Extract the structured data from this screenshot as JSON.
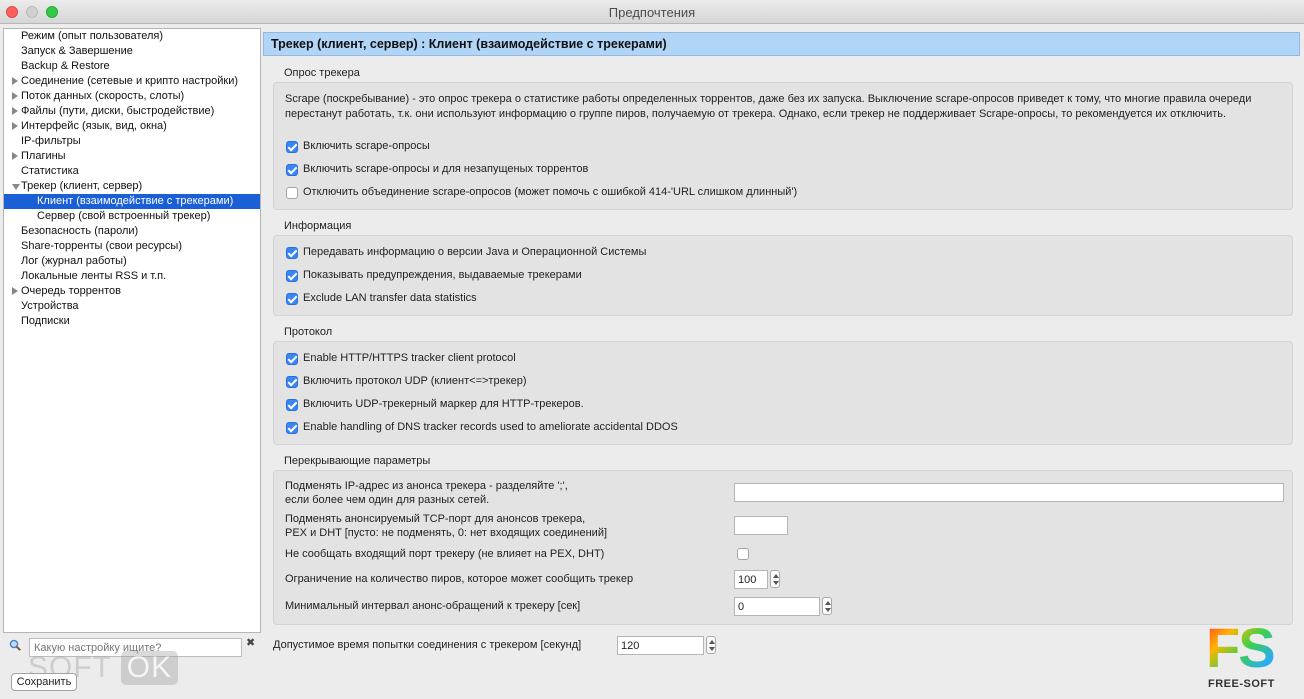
{
  "window": {
    "title": "Предпочтения"
  },
  "sidebar": {
    "items": [
      {
        "label": "Режим (опыт пользователя)",
        "arrow": "none",
        "indent": 0,
        "selected": false
      },
      {
        "label": "Запуск & Завершение",
        "arrow": "none",
        "indent": 0,
        "selected": false
      },
      {
        "label": "Backup & Restore",
        "arrow": "none",
        "indent": 0,
        "selected": false
      },
      {
        "label": "Соединение (сетевые и крипто настройки)",
        "arrow": "right",
        "indent": 0,
        "selected": false
      },
      {
        "label": "Поток данных (скорость, слоты)",
        "arrow": "right",
        "indent": 0,
        "selected": false
      },
      {
        "label": "Файлы (пути, диски, быстродействие)",
        "arrow": "right",
        "indent": 0,
        "selected": false
      },
      {
        "label": "Интерфейс (язык, вид, окна)",
        "arrow": "right",
        "indent": 0,
        "selected": false
      },
      {
        "label": "IP-фильтры",
        "arrow": "none",
        "indent": 0,
        "selected": false
      },
      {
        "label": "Плагины",
        "arrow": "right",
        "indent": 0,
        "selected": false
      },
      {
        "label": "Статистика",
        "arrow": "none",
        "indent": 0,
        "selected": false
      },
      {
        "label": "Трекер (клиент, сервер)",
        "arrow": "down",
        "indent": 0,
        "selected": false
      },
      {
        "label": "Клиент (взаимодейcтвие с трекерами)",
        "arrow": "none",
        "indent": 1,
        "selected": true
      },
      {
        "label": "Сервер (свой встроенный трекер)",
        "arrow": "none",
        "indent": 1,
        "selected": false
      },
      {
        "label": "Безопасность (пароли)",
        "arrow": "none",
        "indent": 0,
        "selected": false
      },
      {
        "label": "Share-торренты (свои ресурсы)",
        "arrow": "none",
        "indent": 0,
        "selected": false
      },
      {
        "label": "Лог (журнал работы)",
        "arrow": "none",
        "indent": 0,
        "selected": false
      },
      {
        "label": "Локальные ленты RSS и т.п.",
        "arrow": "none",
        "indent": 0,
        "selected": false
      },
      {
        "label": "Очередь торрентов",
        "arrow": "right",
        "indent": 0,
        "selected": false
      },
      {
        "label": "Устройства",
        "arrow": "none",
        "indent": 0,
        "selected": false
      },
      {
        "label": "Подписки",
        "arrow": "none",
        "indent": 0,
        "selected": false
      }
    ],
    "search_placeholder": "Какую настройку ищите?",
    "search_clear": "✖",
    "save_label": "Сохранить",
    "watermark_soft": "SOFT",
    "watermark_ok": "OK"
  },
  "header": {
    "title": "Трекер (клиент, сервер) : Клиент (взаимодействие с трекерами)"
  },
  "scrape": {
    "title": "Опрос трекера",
    "description": "Scrape (поскребывание) - это опрос трекера о статистике работы определенных торрентов, даже без их запуска. Выключение scrape-опросов приведет к тому, что многие правила очереди перестанут работать, т.к. они используют информацию о группе пиров, получаемую от трекера. Однако, если трекер не поддерживает Scrape-опросы, то рекомендуется их отключить.",
    "options": [
      {
        "label": "Включить scrape-опросы",
        "checked": true
      },
      {
        "label": "Включить scrape-опросы и для незапущеных торрентов",
        "checked": true
      },
      {
        "label": "Отключить объединение scrape-опросов (может помочь с ошибкой 414-'URL слишком длинный')",
        "checked": false
      }
    ]
  },
  "info": {
    "title": "Информация",
    "options": [
      {
        "label": "Передавать информацию о версии Java и Операционной Системы",
        "checked": true
      },
      {
        "label": "Показывать предупреждения, выдаваемые трекерами",
        "checked": true
      },
      {
        "label": "Exclude LAN transfer data statistics",
        "checked": true
      }
    ]
  },
  "protocol": {
    "title": "Протокол",
    "options": [
      {
        "label": "Enable HTTP/HTTPS tracker client protocol",
        "checked": true
      },
      {
        "label": "Включить протокол UDP (клиент<=>трекер)",
        "checked": true
      },
      {
        "label": "Включить UDP-трекерный маркер для HTTP-трекеров.",
        "checked": true
      },
      {
        "label": "Enable handling of DNS tracker records used to ameliorate accidental DDOS",
        "checked": true
      }
    ]
  },
  "override": {
    "title": "Перекрывающие параметры",
    "ip_label_1": "Подменять IP-адрес из анонса трекера  -  разделяйте ';',",
    "ip_label_2": "если более чем один для разных сетей.",
    "ip_value": "",
    "port_label_1": "Подменять анонсируемый TCP-порт для анонсов трекера,",
    "port_label_2": "PEX и DHT [пусто: не подменять, 0: нет входящих соединений]",
    "port_value": "",
    "noport_label": "Не сообщать входящий порт трекеру (не влияет на PEX, DHT)",
    "noport_checked": false,
    "peers_label": "Ограничение на количество пиров, которое может сообщить трекер",
    "peers_value": "100",
    "interval_label": "Минимальный интервал анонс-обращений к трекеру [сек]",
    "interval_value": "0"
  },
  "timeout": {
    "label": "Допустимое время попытки соединения с трекером [секунд]",
    "value": "120"
  },
  "logo": {
    "letters": "FS",
    "text": "FREE-SOFT"
  }
}
